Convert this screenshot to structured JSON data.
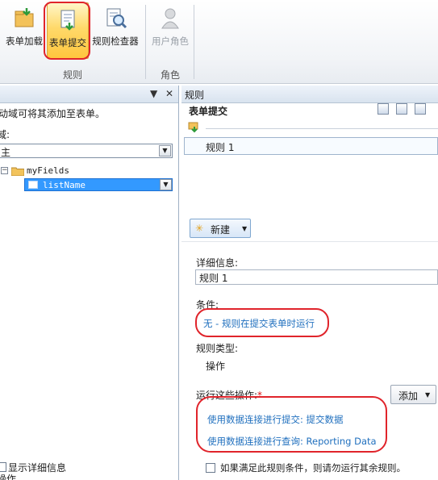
{
  "ribbon": {
    "buttons": [
      {
        "label": "表单加载",
        "icon": "form-load-icon"
      },
      {
        "label": "表单提交",
        "icon": "form-submit-icon"
      },
      {
        "label": "规则检查器",
        "icon": "rule-inspector-icon"
      },
      {
        "label": "用户角色",
        "icon": "user-role-icon"
      }
    ],
    "groups": [
      "规则",
      "角色"
    ]
  },
  "left_pane": {
    "pin_icon": "▼",
    "close_icon": "✕",
    "description": "动域可将其添加至表单。",
    "source_label": "域:",
    "source_value": "主",
    "tree": {
      "root": "myFields",
      "field": "listName"
    },
    "show_details": "显示详细信息",
    "bottom_text": "操作"
  },
  "rules_pane": {
    "title": "规则",
    "subtitle": "表单提交",
    "rule_item": "规则 1",
    "new_button": "新建",
    "details_label": "详细信息:",
    "rule_name_value": "规则 1",
    "condition_label": "条件:",
    "condition_link": "无 - 规则在提交表单时运行",
    "rule_type_label": "规则类型:",
    "rule_type_value": "操作",
    "actions_label": "运行这些操作:",
    "required_mark": "*",
    "add_button": "添加",
    "actions": [
      "使用数据连接进行提交: 提交数据",
      "使用数据连接进行查询: Reporting Data"
    ],
    "stop_rules_text": "如果满足此规则条件，则请勿运行其余规则。"
  },
  "colors": {
    "highlight_ring": "#e0242b",
    "link": "#1f6fbe",
    "selection": "#3399ff"
  }
}
